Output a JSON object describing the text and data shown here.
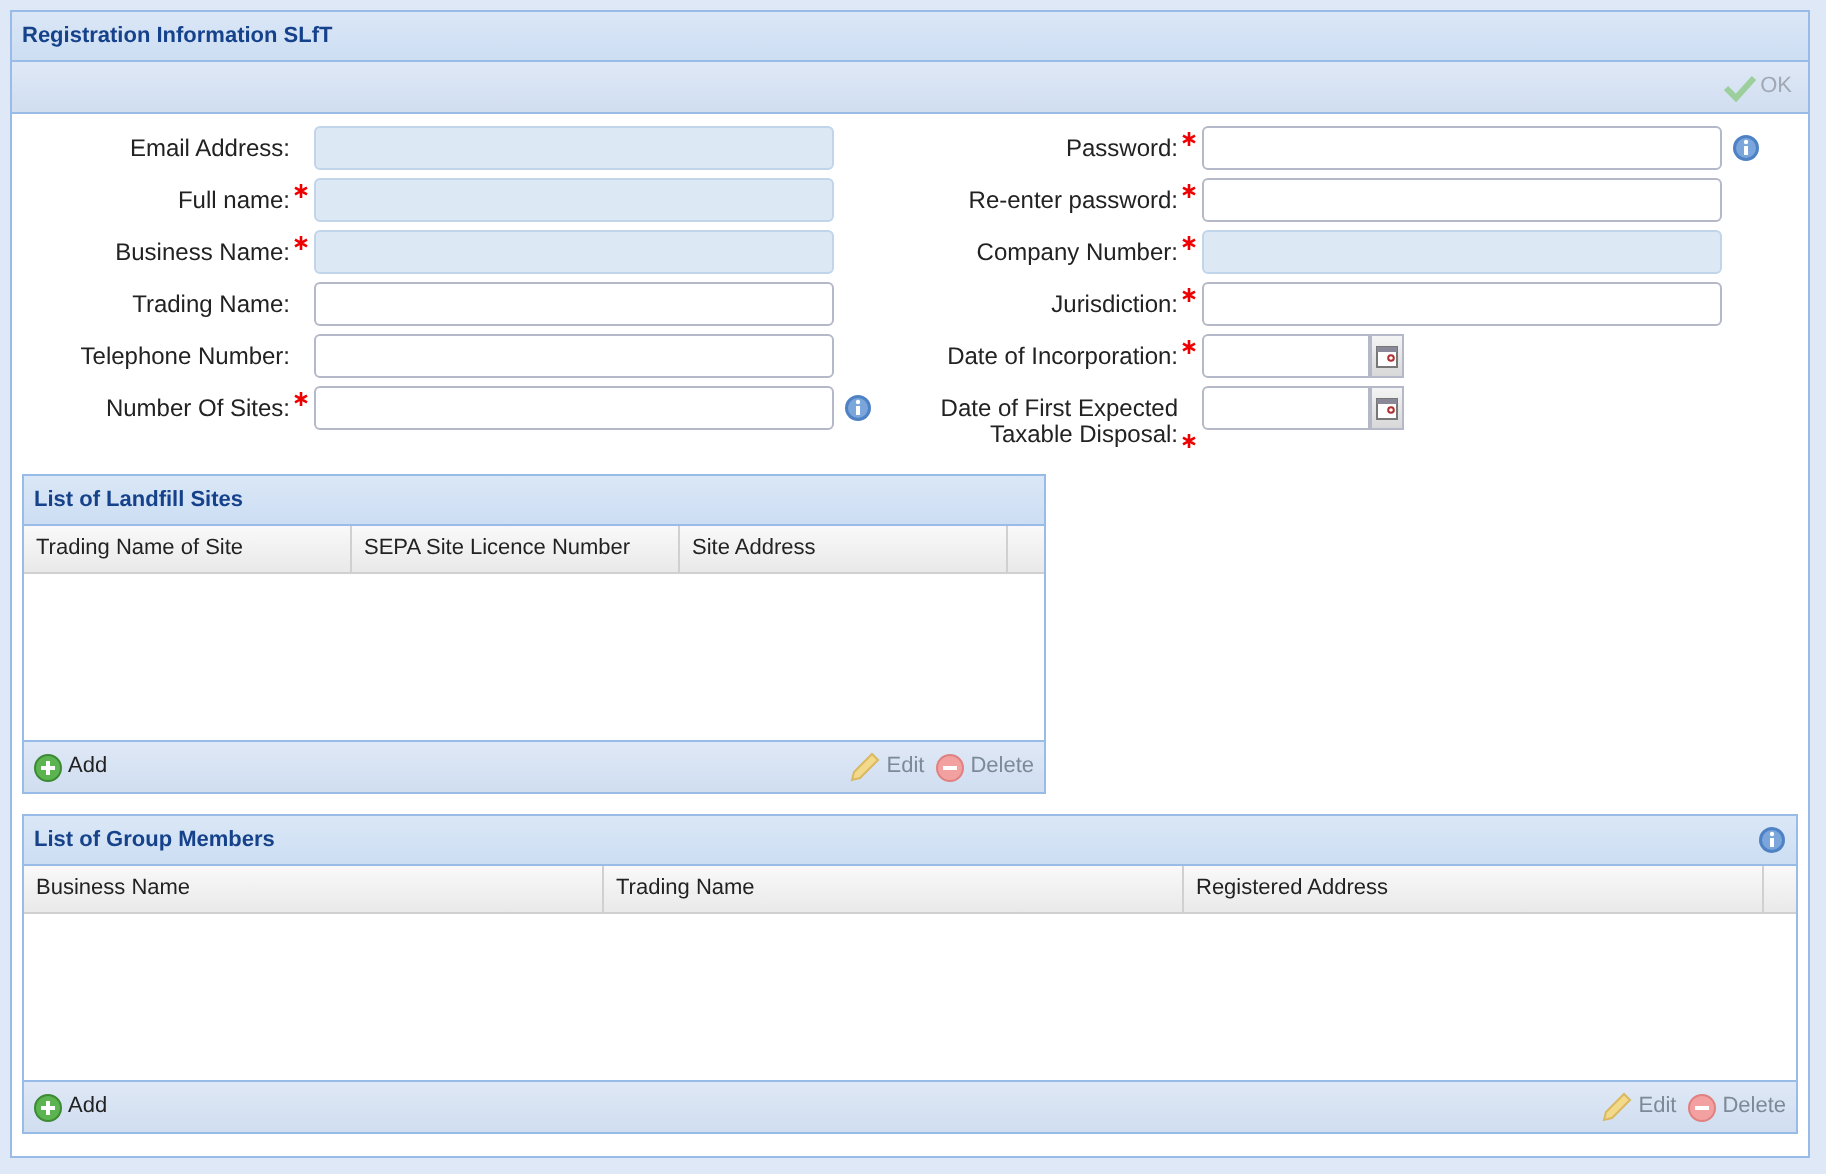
{
  "window": {
    "title": "Registration Information SLfT"
  },
  "toolbar": {
    "ok_button": {
      "label": "OK",
      "disabled": true
    }
  },
  "form_left": [
    {
      "label": "Email Address:",
      "required": false,
      "readonly": true,
      "kind": "text",
      "info": false
    },
    {
      "label": "Full name:",
      "required": true,
      "readonly": true,
      "kind": "text",
      "info": false
    },
    {
      "label": "Business Name:",
      "required": true,
      "readonly": true,
      "kind": "text",
      "info": false
    },
    {
      "label": "Trading Name:",
      "required": false,
      "readonly": false,
      "kind": "text",
      "info": false
    },
    {
      "label": "Telephone Number:",
      "required": false,
      "readonly": false,
      "kind": "text",
      "info": false
    },
    {
      "label": "Number Of Sites:",
      "required": true,
      "readonly": false,
      "kind": "text",
      "info": true
    }
  ],
  "form_right": [
    {
      "label": "Password:",
      "required": true,
      "readonly": false,
      "kind": "text",
      "info": true
    },
    {
      "label": "Re-enter password:",
      "required": true,
      "readonly": false,
      "kind": "text",
      "info": false
    },
    {
      "label": "Company Number:",
      "required": true,
      "readonly": true,
      "kind": "text",
      "info": false
    },
    {
      "label": "Jurisdiction:",
      "required": true,
      "readonly": false,
      "kind": "text",
      "info": false
    },
    {
      "label": "Date of Incorporation:",
      "required": true,
      "readonly": false,
      "kind": "date",
      "info": false
    },
    {
      "label": "Date of First Expected Taxable Disposal:",
      "required": true,
      "readonly": false,
      "kind": "date",
      "info": false
    }
  ],
  "grids": [
    {
      "title": "List of Landfill Sites",
      "info": false,
      "columns": [
        "Trading Name of Site",
        "SEPA Site Licence Number",
        "Site Address"
      ],
      "buttons": [
        {
          "kind": "add",
          "label": "Add",
          "disabled": false
        },
        {
          "kind": "edit",
          "label": "Edit",
          "disabled": true
        },
        {
          "kind": "delete",
          "label": "Delete",
          "disabled": true
        }
      ]
    },
    {
      "title": "List of Group Members",
      "info": true,
      "columns": [
        "Business Name",
        "Trading Name",
        "Registered Address"
      ],
      "buttons": [
        {
          "kind": "add",
          "label": "Add",
          "disabled": false
        },
        {
          "kind": "edit",
          "label": "Edit",
          "disabled": true
        },
        {
          "kind": "delete",
          "label": "Delete",
          "disabled": true
        }
      ]
    }
  ]
}
